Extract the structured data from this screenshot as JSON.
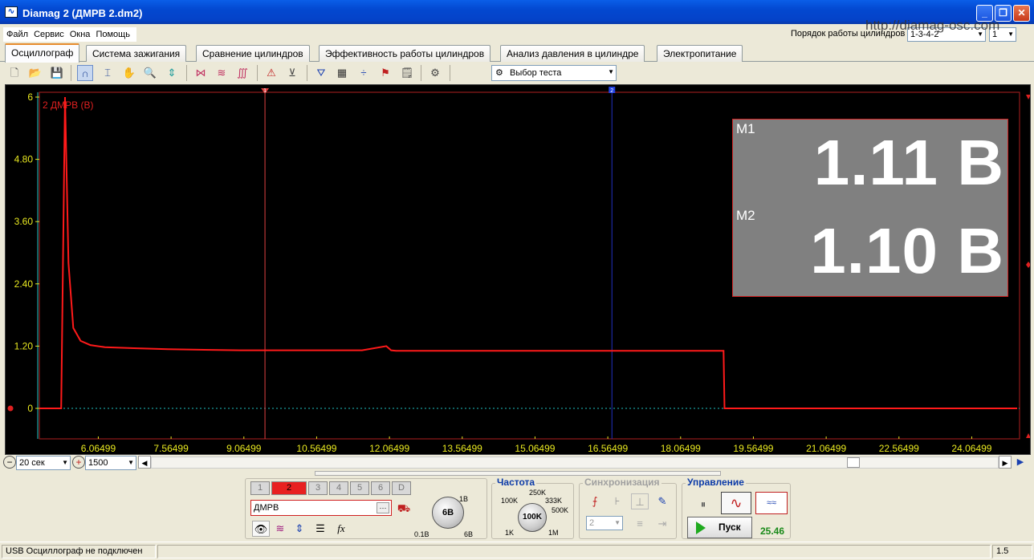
{
  "window": {
    "title": "Diamag 2 (ДМРВ 2.dm2)",
    "icon": "waveform-app-icon"
  },
  "menu": [
    "Файл",
    "Сервис",
    "Окна",
    "Помощь"
  ],
  "header": {
    "cyl_order_label": "Порядок работы цилиндров",
    "cyl_order_value": "1-3-4-2",
    "cyl_value": "1",
    "site": "http://diamag-osc.com"
  },
  "tabs": [
    "Осциллограф",
    "Система зажигания",
    "Сравнение цилиндров",
    "Эффективность работы цилиндров",
    "Анализ давления в цилиндре",
    "Электропитание"
  ],
  "toolbar": {
    "test_select": "Выбор теста"
  },
  "scope": {
    "channel_label": "2 ДМРВ (В)",
    "y_ticks": [
      "6",
      "4.80",
      "3.60",
      "2.40",
      "1.20",
      "0"
    ],
    "x_ticks": [
      "6.06499",
      "7.56499",
      "9.06499",
      "10.56499",
      "12.06499",
      "13.56499",
      "15.06499",
      "16.56499",
      "18.06499",
      "19.56499",
      "21.06499",
      "22.56499",
      "24.06499"
    ],
    "marker1": "1",
    "marker2": "2",
    "trace_color": "#ff1a1a",
    "background": "#000000",
    "tick_color": "#e8e820"
  },
  "chart_data": {
    "type": "line",
    "ylabel": "2 ДМРВ (В)",
    "ylim": [
      0,
      6
    ],
    "xlim": [
      4.85,
      25.05
    ],
    "series": [
      {
        "name": "2 ДМРВ (В)",
        "x": [
          4.85,
          5.3,
          5.38,
          5.45,
          5.55,
          5.7,
          5.9,
          6.2,
          6.8,
          7.5,
          9.0,
          10.0,
          11.5,
          12.0,
          12.1,
          12.2,
          13.5,
          15.0,
          16.5,
          18.0,
          18.95,
          18.97,
          19.5,
          21.0,
          22.5,
          25.0
        ],
        "y": [
          0,
          0,
          6.0,
          2.8,
          1.55,
          1.3,
          1.22,
          1.18,
          1.16,
          1.14,
          1.12,
          1.12,
          1.12,
          1.2,
          1.12,
          1.11,
          1.11,
          1.11,
          1.11,
          1.11,
          1.11,
          0,
          0,
          0,
          0,
          0
        ]
      }
    ]
  },
  "measurements": {
    "m1_label": "M1",
    "m1_value": "1.11 В",
    "m2_label": "M2",
    "m2_value": "1.10 В"
  },
  "controls": {
    "timebase": "20 сек",
    "points": "1500",
    "channels": [
      "1",
      "2",
      "3",
      "4",
      "5",
      "6",
      "D"
    ],
    "channel_name": "ДМРВ",
    "volt_knob": "6В",
    "volt_min": "0.1В",
    "volt_max": "6В",
    "volt_top": "1В",
    "freq_title": "Частота",
    "freq_knob": "100K",
    "freq_labels": [
      "100K",
      "250K",
      "333K",
      "500K",
      "1K",
      "1M"
    ],
    "sync_title": "Синхронизация",
    "sync_channel": "2",
    "control_title": "Управление",
    "run_label": "Пуск",
    "run_value": "25.46"
  },
  "status": {
    "left": "USB Осциллограф не подключен",
    "right": "1.5"
  }
}
